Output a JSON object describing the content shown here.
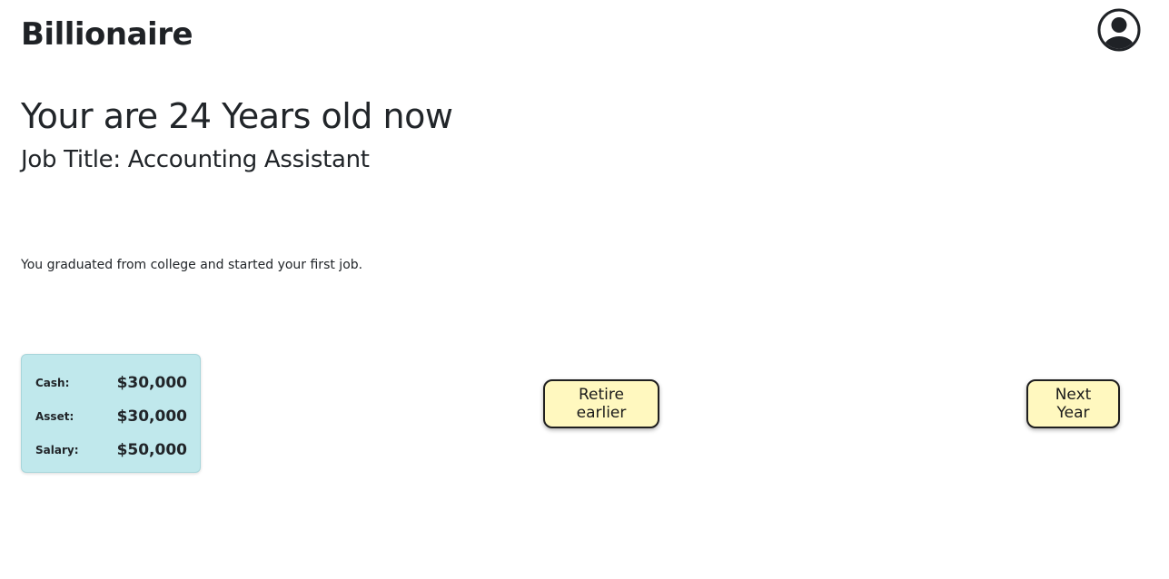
{
  "header": {
    "brand": "Billionaire",
    "avatar_icon": "user-circle-icon"
  },
  "main": {
    "headline": "Your are 24 Years old now",
    "job_title": "Job Title: Accounting Assistant",
    "message": "You graduated from college and started your first job."
  },
  "stats": [
    {
      "label": "Cash:",
      "value": "$30,000"
    },
    {
      "label": "Asset:",
      "value": "$30,000"
    },
    {
      "label": "Salary:",
      "value": "$50,000"
    }
  ],
  "actions": {
    "retire_label": "Retire earlier",
    "next_label": "Next Year"
  },
  "colors": {
    "stats_background": "#c0e8ec",
    "button_background": "#fff8bf",
    "text": "#212529"
  }
}
